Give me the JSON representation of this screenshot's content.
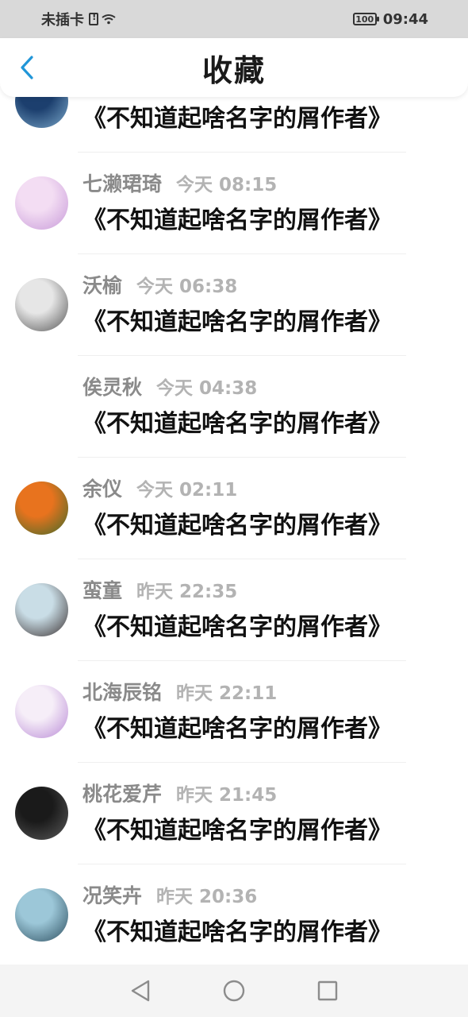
{
  "status_bar": {
    "carrier": "未插卡",
    "battery": "100",
    "time": "09:44"
  },
  "header": {
    "title": "收藏",
    "back_icon": "chevron-left-icon",
    "accent_color": "#2196d8"
  },
  "items": [
    {
      "author": "",
      "time": "",
      "title": "《不知道起啥名字的屑作者》",
      "avatar_colors": [
        "#1c3f6e",
        "#7aa7c9"
      ]
    },
    {
      "author": "七濑珺琦",
      "time": "今天 08:15",
      "title": "《不知道起啥名字的屑作者》",
      "avatar_colors": [
        "#f3ddf3",
        "#c89ad9"
      ]
    },
    {
      "author": "沃榆",
      "time": "今天 06:38",
      "title": "《不知道起啥名字的屑作者》",
      "avatar_colors": [
        "#e6e6e6",
        "#555555"
      ]
    },
    {
      "author": "俟灵秋",
      "time": "今天 04:38",
      "title": "《不知道起啥名字的屑作者》",
      "avatar_colors": [
        "#ffffff",
        "#ffffff"
      ]
    },
    {
      "author": "余仪",
      "time": "今天 02:11",
      "title": "《不知道起啥名字的屑作者》",
      "avatar_colors": [
        "#e8731e",
        "#3f6b2a"
      ]
    },
    {
      "author": "蛮童",
      "time": "昨天 22:35",
      "title": "《不知道起啥名字的屑作者》",
      "avatar_colors": [
        "#c9dde6",
        "#3a3030"
      ]
    },
    {
      "author": "北海辰铭",
      "time": "昨天 22:11",
      "title": "《不知道起啥名字的屑作者》",
      "avatar_colors": [
        "#f6eef8",
        "#b98ad6"
      ]
    },
    {
      "author": "桃花爱芹",
      "time": "昨天 21:45",
      "title": "《不知道起啥名字的屑作者》",
      "avatar_colors": [
        "#1a1a1a",
        "#5a5a5a"
      ]
    },
    {
      "author": "况笑卉",
      "time": "昨天 20:36",
      "title": "《不知道起啥名字的屑作者》",
      "avatar_colors": [
        "#9cc7d8",
        "#2d4f60"
      ]
    }
  ],
  "nav": {
    "back_icon": "triangle-back-icon",
    "home_icon": "circle-home-icon",
    "recent_icon": "square-recents-icon"
  }
}
